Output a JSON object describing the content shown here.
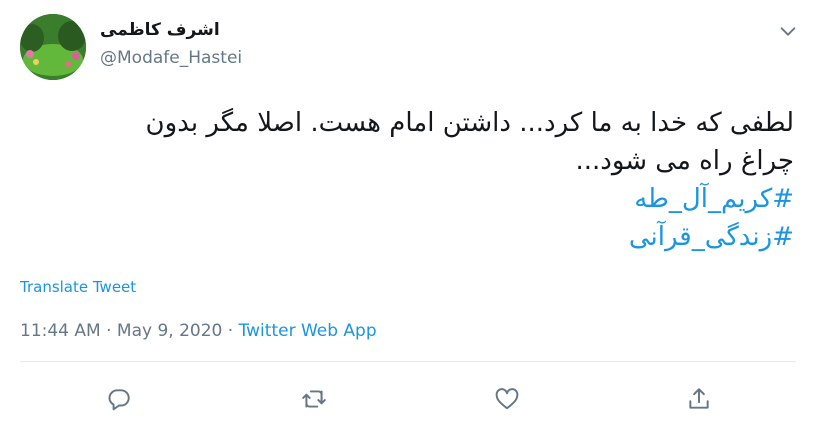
{
  "author": {
    "name": "اشرف کاظمی",
    "handle": "@Modafe_Hastei"
  },
  "tweet": {
    "line1": "لطفی که خدا به ما کرد... داشتن امام هست. اصلا مگر بدون",
    "line2": "چراغ راه می شود...",
    "hashtag1": "#کریم_آل_طه",
    "hashtag2": "#زندگی_قرآنی"
  },
  "translate_label": "Translate Tweet",
  "meta": {
    "time": "11:44 AM",
    "date": "May 9, 2020",
    "separator": "·",
    "source": "Twitter Web App"
  },
  "icons": {
    "menu": "chevron-down-icon",
    "reply": "reply-icon",
    "retweet": "retweet-icon",
    "like": "heart-icon",
    "share": "share-icon"
  },
  "colors": {
    "link": "#1b95e0",
    "secondary_text": "#657786",
    "icon": "#657786"
  }
}
